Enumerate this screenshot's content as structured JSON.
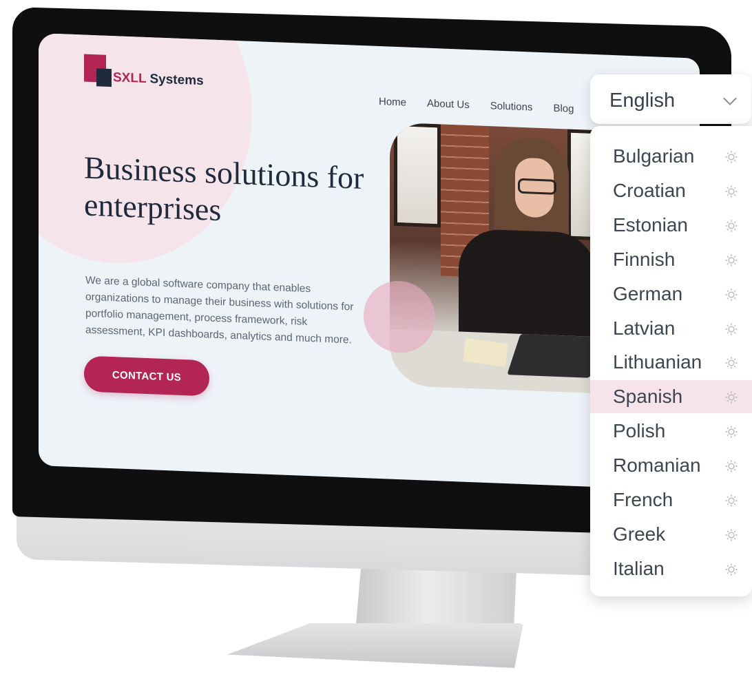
{
  "brand": {
    "name_part1": "SXLL",
    "name_part2": " Systems"
  },
  "nav": [
    "Home",
    "About Us",
    "Solutions",
    "Blog"
  ],
  "hero": {
    "headline": "Business solutions for enterprises",
    "body": "We are a global software company that enables organizations to manage their business with solutions for portfolio management, process framework, risk assessment, KPI dashboards, analytics and much more.",
    "cta_label": "CONTACT US"
  },
  "language_selector": {
    "selected": "English",
    "highlighted": "Spanish",
    "options": [
      "Bulgarian",
      "Croatian",
      "Estonian",
      "Finnish",
      "German",
      "Latvian",
      "Lithuanian",
      "Spanish",
      "Polish",
      "Romanian",
      "French",
      "Greek",
      "Italian"
    ]
  },
  "colors": {
    "accent": "#b22555",
    "navy": "#1f2b3c",
    "highlight": "#f6e4ea"
  },
  "icons": {
    "dropdown": "chevron-down-icon",
    "option": "gear-icon"
  }
}
